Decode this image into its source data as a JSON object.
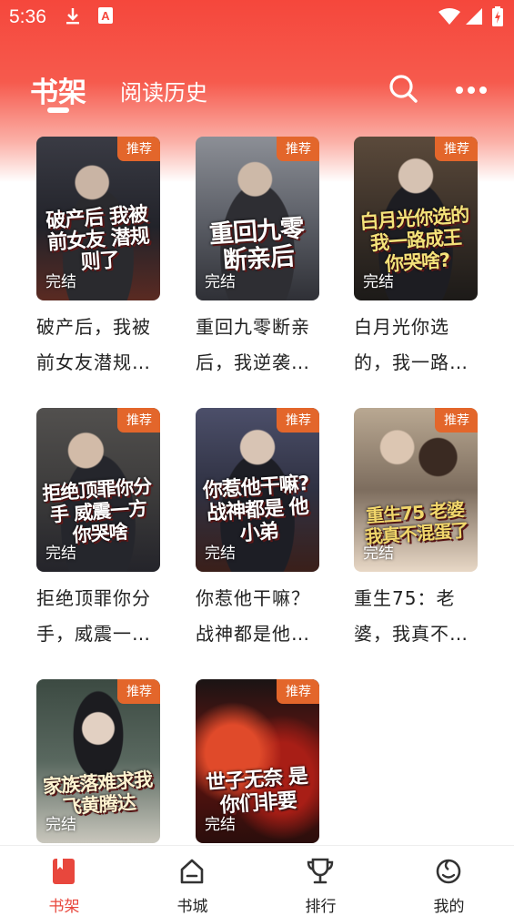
{
  "status": {
    "time": "5:36",
    "icons": [
      "download-icon",
      "a-icon",
      "wifi-icon",
      "signal-icon",
      "battery-icon"
    ]
  },
  "header": {
    "tabs": [
      {
        "label": "书架",
        "active": true
      },
      {
        "label": "阅读历史",
        "active": false
      }
    ],
    "icons": [
      "search-icon",
      "more-icon"
    ]
  },
  "books": [
    {
      "title": "破产后，我被前女友潜规…",
      "cover_text": "破产后 我被前女友 潜规则了",
      "tag": "推荐",
      "status": "完结"
    },
    {
      "title": "重回九零断亲后，我逆袭…",
      "cover_text": "重回九零 断亲后",
      "tag": "推荐",
      "status": "完结"
    },
    {
      "title": "白月光你选的，我一路…",
      "cover_text": "白月光你选的 我一路成王 你哭啥?",
      "tag": "推荐",
      "status": "完结"
    },
    {
      "title": "拒绝顶罪你分手，威震一…",
      "cover_text": "拒绝顶罪你分手 威震一方 你哭啥",
      "tag": "推荐",
      "status": "完结"
    },
    {
      "title": "你惹他干嘛？战神都是他…",
      "cover_text": "你惹他干嘛? 战神都是 他小弟",
      "tag": "推荐",
      "status": "完结"
    },
    {
      "title": "重生75：老婆，我真不…",
      "cover_text": "重生75 老婆 我真不混蛋了",
      "tag": "推荐",
      "status": "完结"
    },
    {
      "title": "",
      "cover_text": "家族落难求我 飞黄腾达",
      "tag": "推荐",
      "status": "完结"
    },
    {
      "title": "",
      "cover_text": "世子无奈 是你们非要",
      "tag": "推荐",
      "status": "完结"
    }
  ],
  "nav": [
    {
      "label": "书架",
      "icon": "bookshelf-icon",
      "active": true
    },
    {
      "label": "书城",
      "icon": "store-icon",
      "active": false
    },
    {
      "label": "排行",
      "icon": "trophy-icon",
      "active": false
    },
    {
      "label": "我的",
      "icon": "profile-icon",
      "active": false
    }
  ],
  "colors": {
    "accent": "#e8473d",
    "header": "#f5473c",
    "tag": "#e3662b"
  }
}
